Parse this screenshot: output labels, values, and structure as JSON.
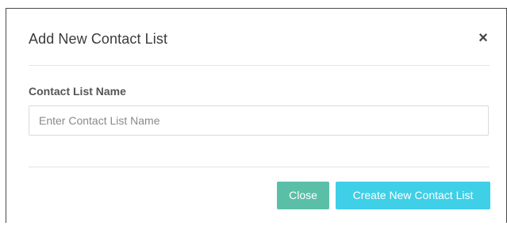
{
  "modal": {
    "title": "Add New Contact List",
    "close_symbol": "×",
    "close_icon": "close-icon"
  },
  "form": {
    "label": "Contact List Name",
    "value": "",
    "placeholder": "Enter Contact List Name"
  },
  "footer": {
    "close_label": "Close",
    "create_label": "Create New Contact List"
  },
  "colors": {
    "close_button": "#5bbfa8",
    "create_button": "#3fcfe7",
    "divider": "#e3e3e3"
  }
}
